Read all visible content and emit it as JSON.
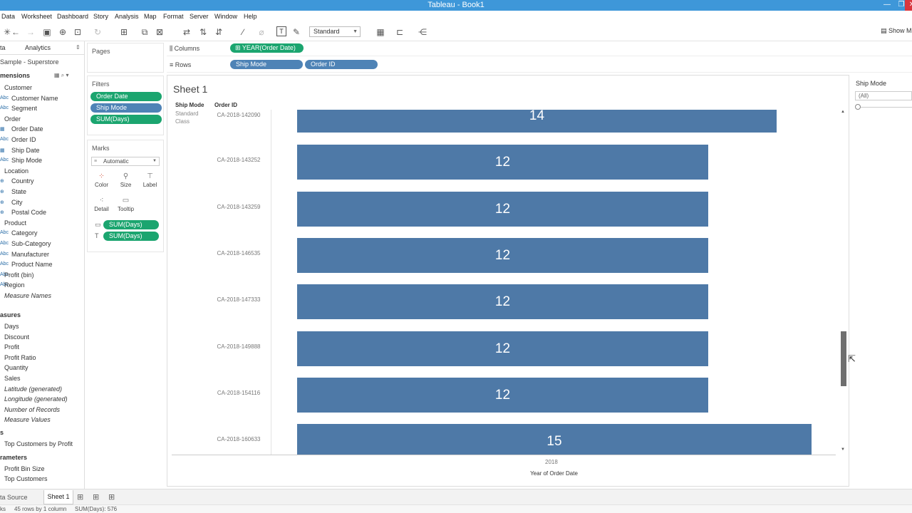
{
  "window": {
    "title": "Tableau - Book1",
    "minimize": "—",
    "restore": "❐",
    "close": "✕"
  },
  "menu": [
    "Data",
    "Worksheet",
    "Dashboard",
    "Story",
    "Analysis",
    "Map",
    "Format",
    "Server",
    "Window",
    "Help"
  ],
  "toolbar": {
    "fit": "Standard",
    "show_me": "Show M"
  },
  "data_pane": {
    "tab_data": "ta",
    "tab_analytics": "Analytics",
    "source": "Sample - Superstore",
    "dimensions_header": "mensions",
    "dimensions": [
      {
        "label": "Customer",
        "type": "folder"
      },
      {
        "label": "Customer Name",
        "type": "abc"
      },
      {
        "label": "Segment",
        "type": "abc"
      },
      {
        "label": "Order",
        "type": "folder"
      },
      {
        "label": "Order Date",
        "type": "date"
      },
      {
        "label": "Order ID",
        "type": "abc"
      },
      {
        "label": "Ship Date",
        "type": "date"
      },
      {
        "label": "Ship Mode",
        "type": "abc"
      },
      {
        "label": "Location",
        "type": "folder"
      },
      {
        "label": "Country",
        "type": "geo"
      },
      {
        "label": "State",
        "type": "geo"
      },
      {
        "label": "City",
        "type": "geo"
      },
      {
        "label": "Postal Code",
        "type": "geo"
      },
      {
        "label": "Product",
        "type": "folder"
      },
      {
        "label": "Category",
        "type": "abc"
      },
      {
        "label": "Sub-Category",
        "type": "abc"
      },
      {
        "label": "Manufacturer",
        "type": "abc"
      },
      {
        "label": "Product Name",
        "type": "abc"
      },
      {
        "label": "Profit (bin)",
        "type": "abc"
      },
      {
        "label": "Region",
        "type": "abc"
      },
      {
        "label": "Measure Names",
        "type": "italic"
      }
    ],
    "measures_header": "asures",
    "measures": [
      {
        "label": "Days",
        "italic": false
      },
      {
        "label": "Discount",
        "italic": false
      },
      {
        "label": "Profit",
        "italic": false
      },
      {
        "label": "Profit Ratio",
        "italic": false
      },
      {
        "label": "Quantity",
        "italic": false
      },
      {
        "label": "Sales",
        "italic": false
      },
      {
        "label": "Latitude (generated)",
        "italic": true
      },
      {
        "label": "Longitude (generated)",
        "italic": true
      },
      {
        "label": "Number of Records",
        "italic": true
      },
      {
        "label": "Measure Values",
        "italic": true
      }
    ],
    "sets_header": "s",
    "sets": [
      "Top Customers by Profit"
    ],
    "parameters_header": "rameters",
    "parameters": [
      "Profit Bin Size",
      "Top Customers"
    ]
  },
  "pages": {
    "title": "Pages"
  },
  "filters": {
    "title": "Filters",
    "pills": [
      {
        "label": "Order Date",
        "color": "green"
      },
      {
        "label": "Ship Mode",
        "color": "blue"
      },
      {
        "label": "SUM(Days)",
        "color": "green"
      }
    ]
  },
  "marks": {
    "title": "Marks",
    "type": "Automatic",
    "buttons": [
      "Color",
      "Size",
      "Label",
      "Detail",
      "Tooltip"
    ],
    "pills": [
      "SUM(Days)",
      "SUM(Days)"
    ]
  },
  "shelves": {
    "columns_label": "Columns",
    "columns_pill": "YEAR(Order Date)",
    "rows_label": "Rows",
    "rows_pills": [
      "Ship Mode",
      "Order ID"
    ]
  },
  "view": {
    "sheet_title": "Sheet 1",
    "header_ship_mode": "Ship Mode",
    "header_order_id": "Order ID",
    "ship_mode_value_1": "Standard",
    "ship_mode_value_2": "Class",
    "x_tick": "2018",
    "x_label": "Year of Order Date"
  },
  "chart_data": {
    "type": "bar",
    "orientation": "horizontal",
    "categories": [
      "CA-2018-142090",
      "CA-2018-143252",
      "CA-2018-143259",
      "CA-2018-146535",
      "CA-2018-147333",
      "CA-2018-149888",
      "CA-2018-154116",
      "CA-2018-160633"
    ],
    "values": [
      14,
      12,
      12,
      12,
      12,
      12,
      12,
      15
    ],
    "xlabel": "Year of Order Date",
    "bar_color": "#4e79a7"
  },
  "legend": {
    "title": "Ship Mode",
    "value": "(All)"
  },
  "tabs": {
    "data_source": "ta Source",
    "sheet": "Sheet 1"
  },
  "status": {
    "left": "ks",
    "rows": "45 rows by 1 column",
    "sum": "SUM(Days): 576"
  }
}
